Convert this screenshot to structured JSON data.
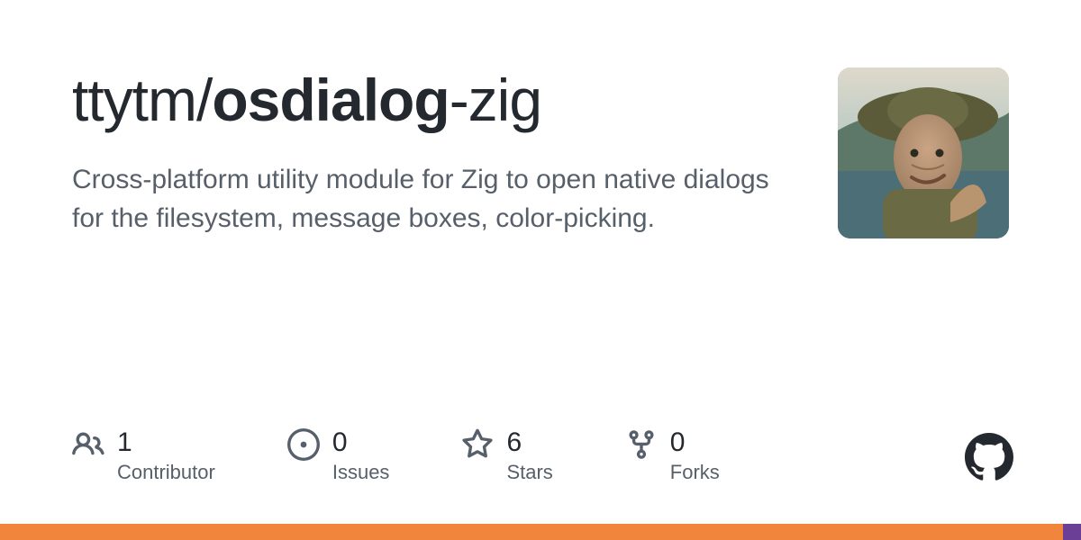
{
  "repo": {
    "owner": "ttytm",
    "separator": "/",
    "name": "osdialog",
    "suffix": "-zig",
    "description": "Cross-platform utility module for Zig to open native dialogs for the filesystem, message boxes, color-picking."
  },
  "stats": {
    "contributors": {
      "count": "1",
      "label": "Contributor"
    },
    "issues": {
      "count": "0",
      "label": "Issues"
    },
    "stars": {
      "count": "6",
      "label": "Stars"
    },
    "forks": {
      "count": "0",
      "label": "Forks"
    }
  },
  "accent_colors": [
    "#f1853c",
    "#6c3f97"
  ],
  "accent_widths": [
    "98.3%",
    "1.7%"
  ]
}
